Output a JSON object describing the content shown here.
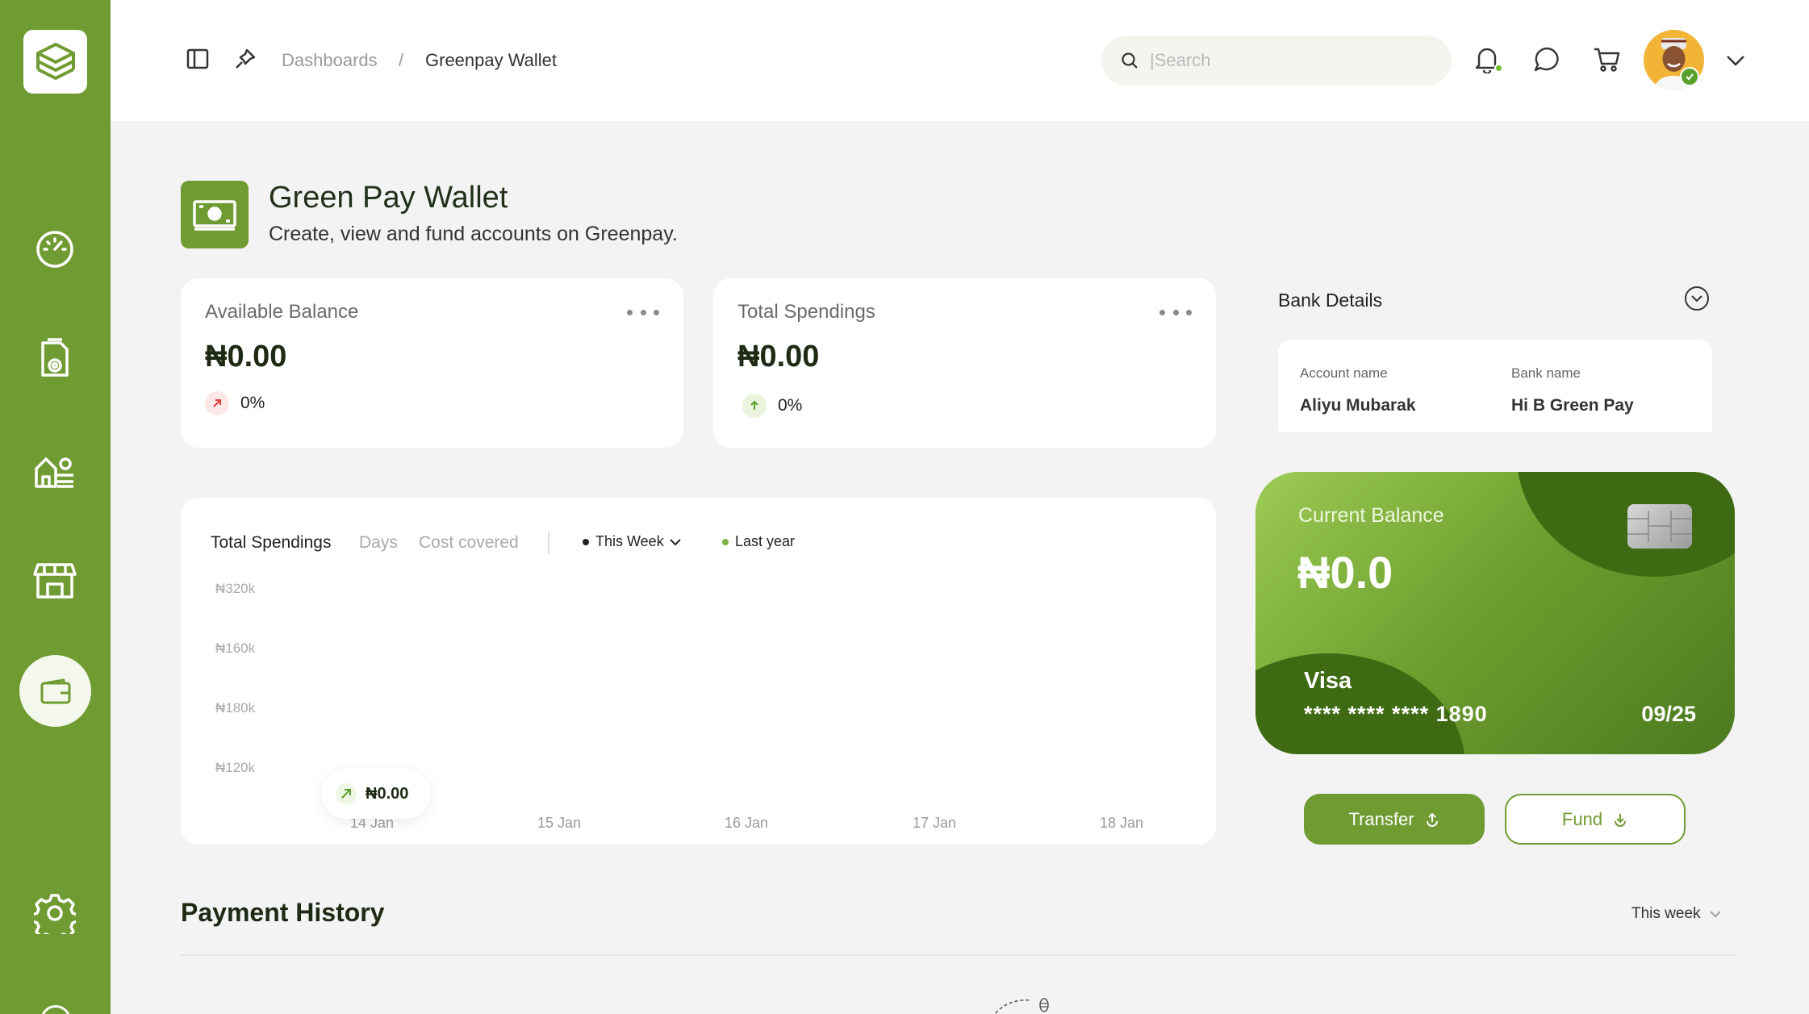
{
  "breadcrumb": {
    "parent": "Dashboards",
    "separator": "/",
    "current": "Greenpay Wallet"
  },
  "search": {
    "placeholder": "|Search"
  },
  "header": {
    "title": "Green Pay Wallet",
    "subtitle": "Create, view and fund accounts on Greenpay."
  },
  "stats": [
    {
      "label": "Available Balance",
      "value": "₦0.00",
      "change": "0%"
    },
    {
      "label": "Total Spendings",
      "value": "₦0.00",
      "change": "0%"
    }
  ],
  "chart": {
    "tabs": [
      "Total Spendings",
      "Days",
      "Cost covered"
    ],
    "period_select": "This Week",
    "legend_last_year": "Last year",
    "tooltip_value": "₦0.00"
  },
  "chart_data": {
    "type": "line",
    "y_ticks": [
      "₦320k",
      "₦160k",
      "₦180k",
      "₦120k"
    ],
    "x_ticks": [
      "14 Jan",
      "15 Jan",
      "16 Jan",
      "17 Jan",
      "18 Jan"
    ],
    "series": [
      {
        "name": "This Week",
        "values": []
      },
      {
        "name": "Last year",
        "values": []
      }
    ]
  },
  "bank": {
    "title": "Bank Details",
    "account_name_label": "Account name",
    "account_name": "Aliyu Mubarak",
    "bank_name_label": "Bank name",
    "bank_name": "Hi B Green Pay"
  },
  "card": {
    "label": "Current Balance",
    "balance": "₦0.0",
    "brand": "Visa",
    "number": "**** **** **** 1890",
    "expiry": "09/25"
  },
  "actions": {
    "transfer": "Transfer",
    "fund": "Fund"
  },
  "payment_history": {
    "title": "Payment History",
    "filter": "This week"
  },
  "colors": {
    "brand": "#6f9b32",
    "brand_dark": "#3e6a13",
    "background": "#f3f3f3"
  }
}
